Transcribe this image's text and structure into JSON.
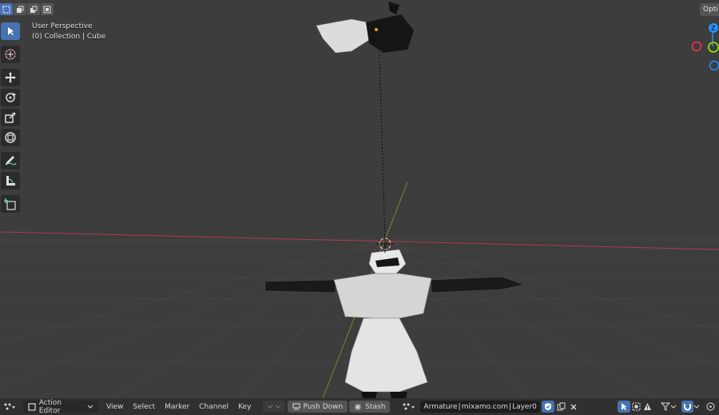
{
  "viewport": {
    "view_name": "User Perspective",
    "collection_info": "(0) Collection | Cube",
    "options_label": "Opti"
  },
  "gizmo": {
    "z_label": "Z",
    "x_color": "#ff3352",
    "y_color": "#8bdc00",
    "z_color": "#2890ff"
  },
  "colors": {
    "active_blue": "#4772b3",
    "viewport_bg": "#3d3d3d",
    "header_bg": "#303030"
  },
  "tools": [
    {
      "name": "select-box-tool",
      "icon": "cursor-arrow-icon",
      "active": true
    },
    {
      "name": "cursor-tool",
      "icon": "3d-cursor-icon"
    },
    {
      "name": "move-tool",
      "icon": "move-arrows-icon"
    },
    {
      "name": "rotate-tool",
      "icon": "rotate-icon"
    },
    {
      "name": "scale-tool",
      "icon": "scale-icon"
    },
    {
      "name": "transform-tool",
      "icon": "transform-icon"
    },
    {
      "name": "annotate-tool",
      "icon": "annotate-pencil-icon"
    },
    {
      "name": "measure-tool",
      "icon": "ruler-icon"
    },
    {
      "name": "add-cube-tool",
      "icon": "add-cube-icon"
    }
  ],
  "statusbar": {
    "editor_type_icon": "dopesheet-icon",
    "mode_label": "Action Editor",
    "menus": [
      "View",
      "Select",
      "Marker",
      "Channel",
      "Key"
    ],
    "push_down_label": "Push Down",
    "stash_label": "Stash",
    "armature_object": "Armature",
    "action_name": "mixamo.com",
    "layer_name": "Layer0"
  }
}
